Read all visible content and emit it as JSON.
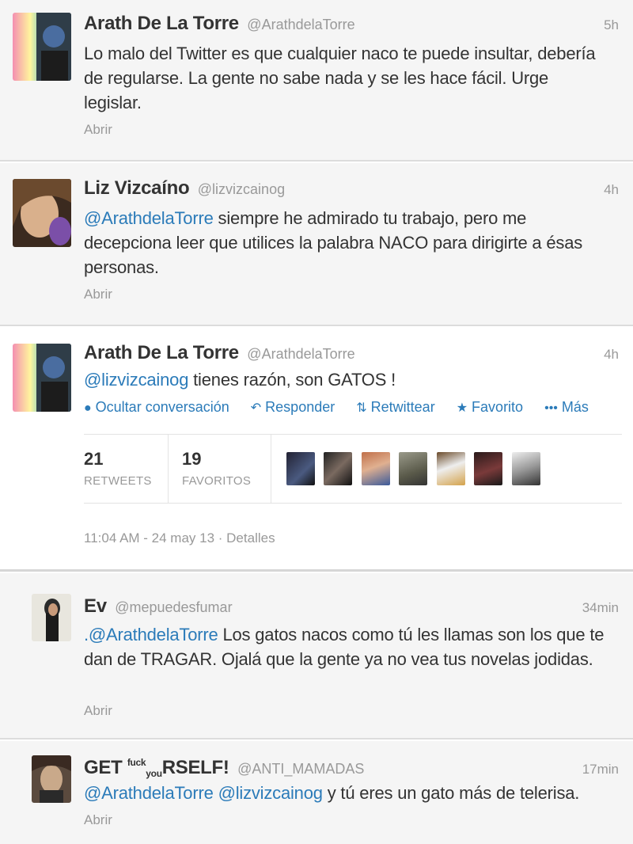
{
  "tweets": [
    {
      "name": "Arath De La Torre",
      "handle": "@ArathdelaTorre",
      "time": "5h",
      "text": "Lo malo del Twitter es que cualquier naco te puede insultar, debería de regularse. La gente no sabe nada y se les hace fácil. Urge legislar.",
      "open": "Abrir"
    },
    {
      "name": "Liz Vizcaíno",
      "handle": "@lizvizcainog",
      "time": "4h",
      "mention": "@ArathdelaTorre",
      "text": " siempre he admirado tu trabajo, pero me decepciona leer que utilices la palabra NACO para dirigirte a ésas personas.",
      "open": "Abrir"
    },
    {
      "name": "Arath De La Torre",
      "handle": "@ArathdelaTorre",
      "time": "4h",
      "mention": "@lizvizcainog",
      "text": " tienes razón, son GATOS !",
      "actions": {
        "hide": "Ocultar conversación",
        "reply": "Responder",
        "retweet": "Retwittear",
        "favorite": "Favorito",
        "more": "Más"
      },
      "stats": {
        "retweets_count": "21",
        "retweets_label": "RETWEETS",
        "favorites_count": "19",
        "favorites_label": "FAVORITOS"
      },
      "timestamp": "11:04 AM - 24 may 13 · Detalles"
    },
    {
      "name": "Ev",
      "handle": "@mepuedesfumar",
      "time": "34min",
      "mention": ".@ArathdelaTorre",
      "text": " Los gatos nacos como tú les llamas son los que te dan de TRAGAR. Ojalá que la gente ya no vea tus novelas jodidas.",
      "open": "Abrir"
    },
    {
      "name_a": "GET ",
      "name_b": "fuck",
      "name_c": "you",
      "name_d": "RSELF!",
      "handle": "@ANTI_MAMADAS",
      "time": "17min",
      "mention1": "@ArathdelaTorre",
      "mention2": "@lizvizcainog",
      "text": " y tú eres un gato más de telerisa.",
      "open": "Abrir"
    }
  ],
  "icons": [
    "comment-bubble-icon",
    "reply-arrow-icon",
    "retweet-icon",
    "star-icon",
    "more-dots-icon"
  ],
  "colors": {
    "link": "#2b7bb9",
    "muted": "#999999",
    "text": "#333333",
    "bg": "#f5f5f5"
  }
}
